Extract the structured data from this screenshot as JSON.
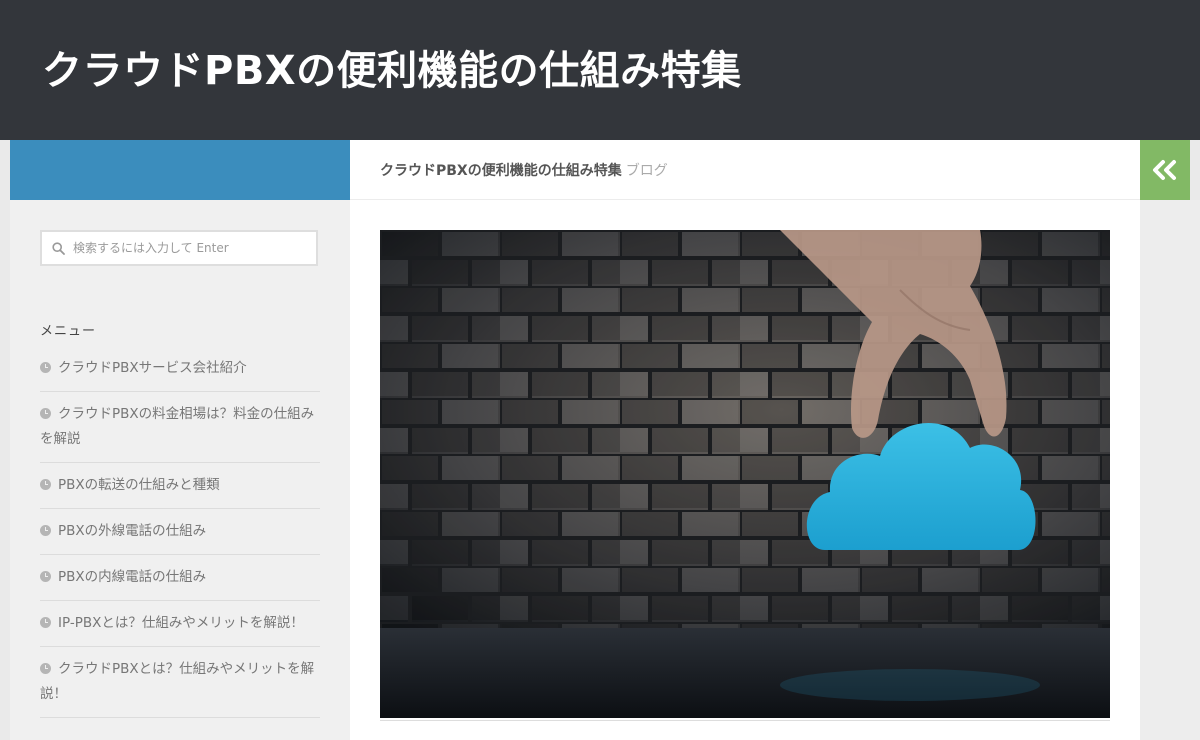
{
  "site": {
    "title": "クラウドPBXの便利機能の仕組み特集"
  },
  "breadcrumb": {
    "current": "クラウドPBXの便利機能の仕組み特集",
    "section": "ブログ"
  },
  "search": {
    "placeholder": "検索するには入力して Enter"
  },
  "sidebar": {
    "heading": "メニュー",
    "items": [
      {
        "label": "クラウドPBXサービス会社紹介"
      },
      {
        "label": "クラウドPBXの料金相場は？料金の仕組みを解説"
      },
      {
        "label": "PBXの転送の仕組みと種類"
      },
      {
        "label": "PBXの外線電話の仕組み"
      },
      {
        "label": "PBXの内線電話の仕組み"
      },
      {
        "label": "IP-PBXとは？仕組みやメリットを解説！"
      },
      {
        "label": "クラウドPBXとは？仕組みやメリットを解説！"
      }
    ]
  },
  "icons": {
    "toggle": "double-chevron-left-icon",
    "search": "search-icon",
    "menu_item": "clock-icon"
  },
  "colors": {
    "header_bg": "#33363b",
    "sidebar_accent": "#3b8dbd",
    "toggle_bg": "#82b965",
    "cloud": "#2aaed6"
  }
}
